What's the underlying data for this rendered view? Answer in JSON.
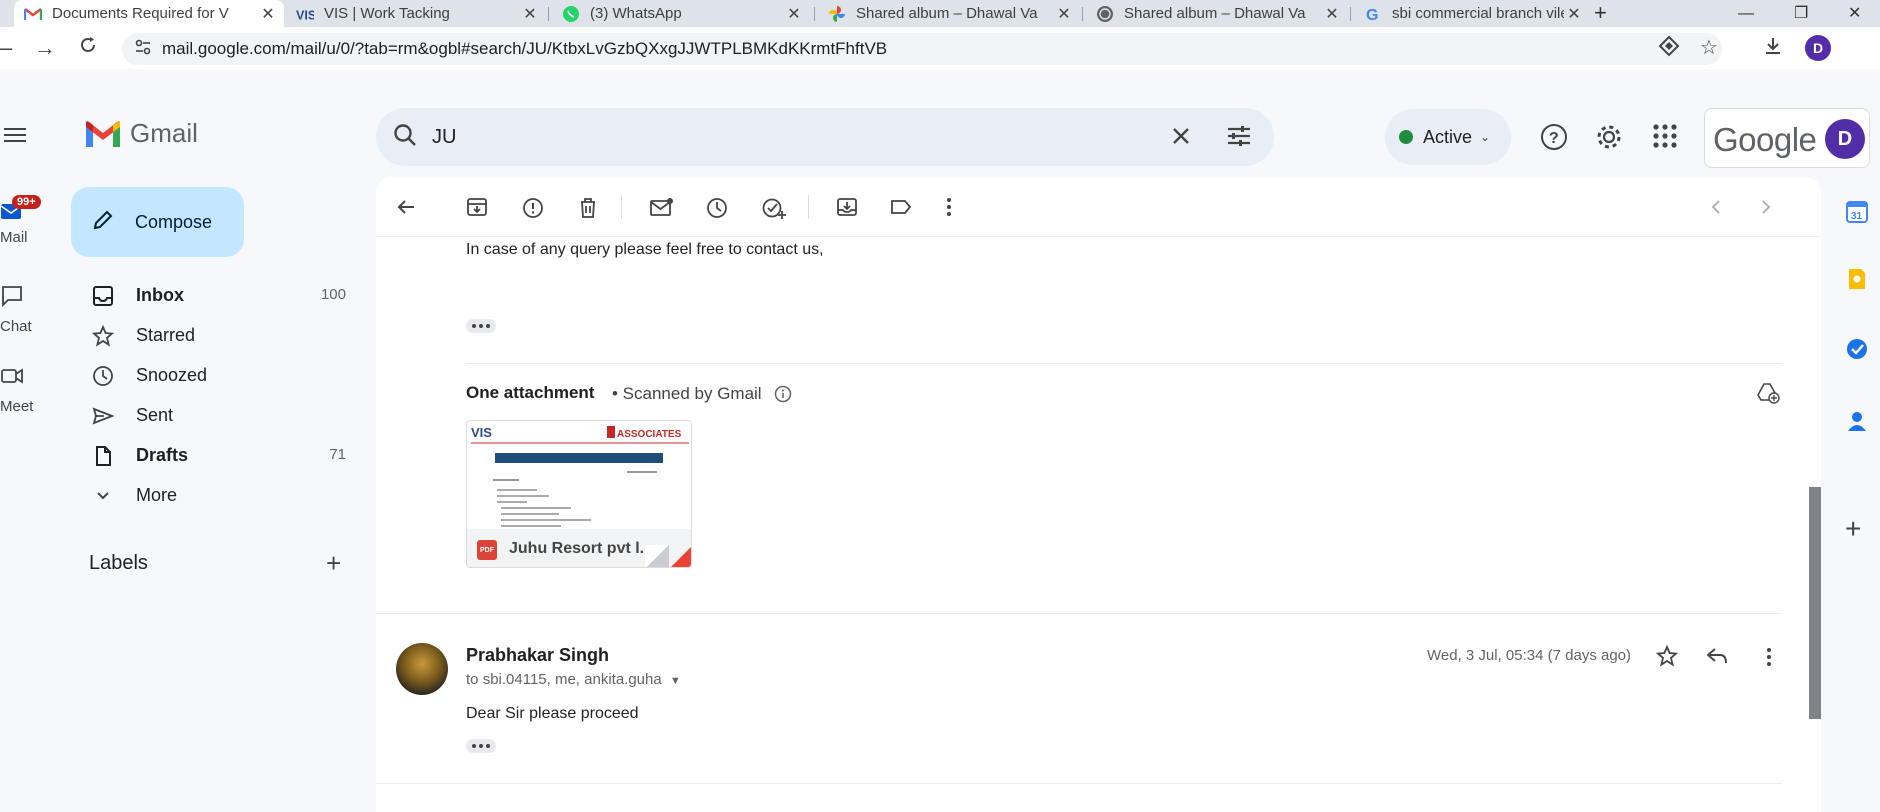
{
  "browser": {
    "tabs": [
      {
        "title": "Documents Required for V",
        "icon": "gmail-icon",
        "active": true
      },
      {
        "title": "VIS | Work Tacking",
        "icon": "vis-icon"
      },
      {
        "title": "(3) WhatsApp",
        "icon": "whatsapp-icon"
      },
      {
        "title": "Shared album – Dhawal Va",
        "icon": "google-photos-icon"
      },
      {
        "title": "Shared album – Dhawal Va",
        "icon": "globe-icon"
      },
      {
        "title": "sbi commercial branch vile",
        "icon": "google-icon"
      }
    ],
    "url": "mail.google.com/mail/u/0/?tab=rm&ogbl#search/JU/KtbxLvGzbQXxgJJWTPLBMKdKKrmtFhftVB",
    "profile_initial": "D"
  },
  "gmail": {
    "logo_text": "Gmail",
    "search_value": "JU",
    "status_label": "Active",
    "account_initial": "D",
    "google_word": "Google",
    "rail": {
      "mail_label": "Mail",
      "mail_badge": "99+",
      "chat_label": "Chat",
      "meet_label": "Meet"
    },
    "compose_label": "Compose",
    "nav": [
      {
        "label": "Inbox",
        "count": "100",
        "bold": true,
        "icon": "inbox-icon"
      },
      {
        "label": "Starred",
        "count": "",
        "icon": "star-icon"
      },
      {
        "label": "Snoozed",
        "count": "",
        "icon": "clock-icon"
      },
      {
        "label": "Sent",
        "count": "",
        "icon": "send-icon"
      },
      {
        "label": "Drafts",
        "count": "71",
        "bold": true,
        "icon": "draft-icon"
      },
      {
        "label": "More",
        "count": "",
        "icon": "chevron-down-icon"
      }
    ],
    "labels_heading": "Labels"
  },
  "thread": {
    "partial_line": "In case of any query please feel free to contact us,",
    "attachment_heading": "One attachment",
    "scanned_text": "• Scanned by Gmail",
    "attachment_name": "Juhu Resort pvt l...",
    "attachment_type": "PDF",
    "preview": {
      "left_logo": "VIS",
      "right_logo": "ASSOCIATES"
    },
    "message": {
      "sender": "Prabhakar Singh",
      "recipients": "sbi.04115, me, ankita.guha",
      "to_prefix": "to",
      "date": "Wed, 3 Jul, 05:34 (7 days ago)",
      "body": "Dear Sir  please proceed"
    }
  }
}
